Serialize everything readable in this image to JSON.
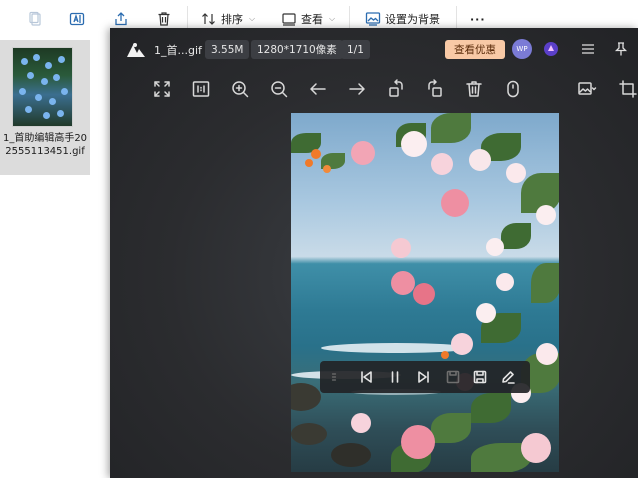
{
  "explorer": {
    "toolbar": {
      "sort_label": "排序",
      "view_label": "查看",
      "set_background_label": "设置为背景",
      "more_label": "···"
    },
    "file": {
      "name": "1_首助编辑高手202555113451.gif"
    }
  },
  "viewer": {
    "title": "1_首...gif",
    "file_size": "3.55M",
    "dimensions": "1280*1710像素",
    "page_counter": "1/1",
    "promo_label": "查看优惠",
    "avatar_text": "WP",
    "toolbar_icons": [
      "fullscreen-icon",
      "actual-size-icon",
      "zoom-in-icon",
      "zoom-out-icon",
      "previous-icon",
      "next-icon",
      "rotate-left-icon",
      "rotate-right-icon",
      "delete-icon",
      "info-icon"
    ],
    "playbar_icons": [
      "menu-handle-icon",
      "first-frame-icon",
      "pause-icon",
      "next-frame-icon",
      "save-frame-icon",
      "save-icon",
      "edit-icon"
    ]
  },
  "colors": {
    "viewer_bg": "#2a2b2d",
    "promo_bg": "#f8c9a6",
    "tile_selected": "#dcdcdc"
  }
}
